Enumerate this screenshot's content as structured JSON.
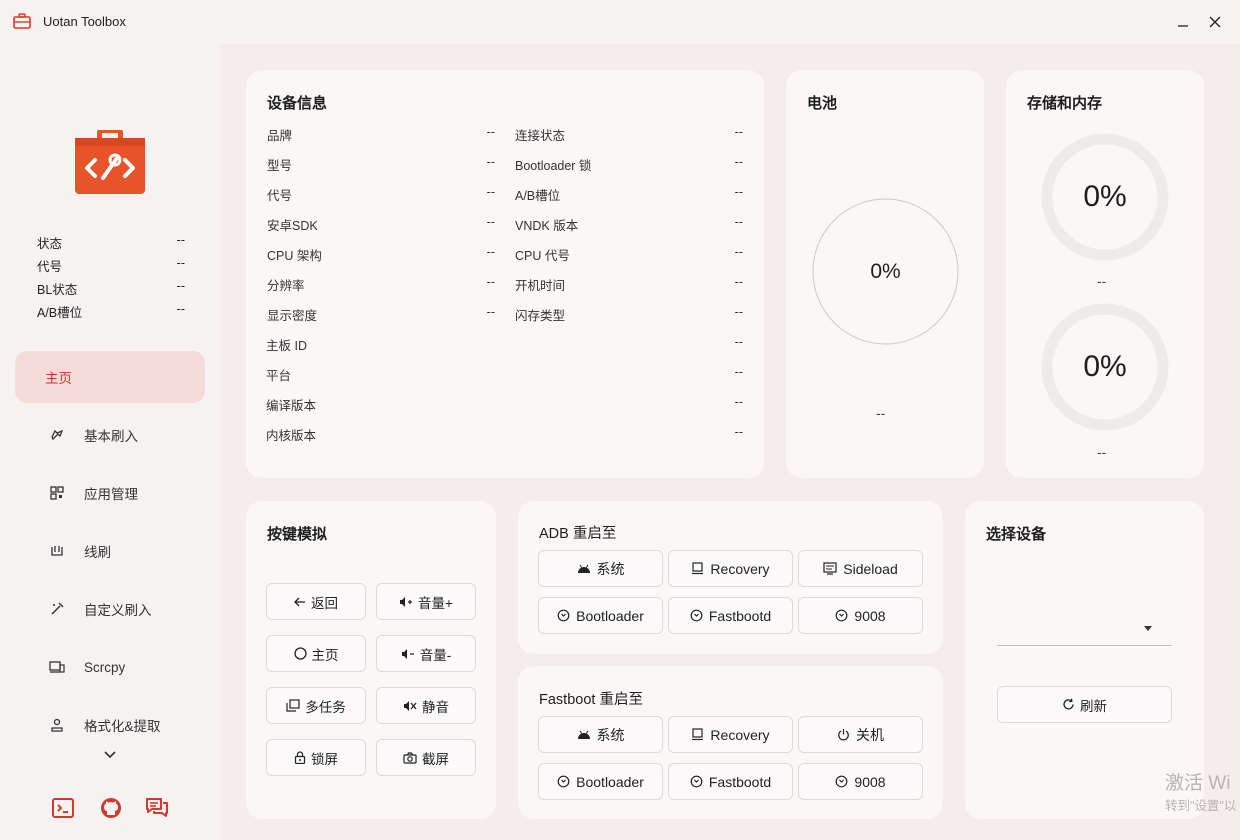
{
  "window": {
    "title": "Uotan Toolbox",
    "minimize": "−",
    "close": "✕"
  },
  "sidebar": {
    "status": [
      {
        "label": "状态",
        "value": "--"
      },
      {
        "label": "代号",
        "value": "--"
      },
      {
        "label": "BL状态",
        "value": "--"
      },
      {
        "label": "A/B槽位",
        "value": "--"
      }
    ],
    "nav": [
      {
        "label": "主页",
        "icon": "home-icon"
      },
      {
        "label": "基本刷入",
        "icon": "flash-icon"
      },
      {
        "label": "应用管理",
        "icon": "apps-icon"
      },
      {
        "label": "线刷",
        "icon": "wire-icon"
      },
      {
        "label": "自定义刷入",
        "icon": "custom-icon"
      },
      {
        "label": "Scrcpy",
        "icon": "screen-icon"
      },
      {
        "label": "格式化&提取",
        "icon": "format-icon"
      }
    ],
    "bottom_icons": [
      "terminal-icon",
      "github-icon",
      "chat-icon"
    ]
  },
  "device_info": {
    "title": "设备信息",
    "left": [
      {
        "label": "品牌",
        "value": "--"
      },
      {
        "label": "型号",
        "value": "--"
      },
      {
        "label": "代号",
        "value": "--"
      },
      {
        "label": "安卓SDK",
        "value": "--"
      },
      {
        "label": "CPU 架构",
        "value": "--"
      },
      {
        "label": "分辨率",
        "value": "--"
      },
      {
        "label": "显示密度",
        "value": "--"
      }
    ],
    "right": [
      {
        "label": "连接状态",
        "value": "--"
      },
      {
        "label": "Bootloader 锁",
        "value": "--"
      },
      {
        "label": "A/B槽位",
        "value": "--"
      },
      {
        "label": "VNDK 版本",
        "value": "--"
      },
      {
        "label": "CPU 代号",
        "value": "--"
      },
      {
        "label": "开机时间",
        "value": "--"
      },
      {
        "label": "闪存类型",
        "value": "--"
      }
    ],
    "full": [
      {
        "label": "主板 ID",
        "value": "--"
      },
      {
        "label": "平台",
        "value": "--"
      },
      {
        "label": "编译版本",
        "value": "--"
      },
      {
        "label": "内核版本",
        "value": "--"
      }
    ]
  },
  "battery": {
    "title": "电池",
    "percent": "0%",
    "status": "--"
  },
  "storage": {
    "title": "存储和内存",
    "storage_percent": "0%",
    "storage_detail": "--",
    "memory_percent": "0%",
    "memory_detail": "--"
  },
  "keys": {
    "title": "按键模拟",
    "buttons": [
      {
        "label": "返回",
        "icon": "arrow-left-icon"
      },
      {
        "label": "音量+",
        "icon": "volume-up-icon"
      },
      {
        "label": "主页",
        "icon": "circle-icon"
      },
      {
        "label": "音量-",
        "icon": "volume-down-icon"
      },
      {
        "label": "多任务",
        "icon": "multitask-icon"
      },
      {
        "label": "静音",
        "icon": "mute-icon"
      },
      {
        "label": "锁屏",
        "icon": "lock-icon"
      },
      {
        "label": "截屏",
        "icon": "camera-icon"
      }
    ]
  },
  "adb_reboot": {
    "title": "ADB 重启至",
    "buttons": [
      {
        "label": "系统",
        "icon": "android-icon"
      },
      {
        "label": "Recovery",
        "icon": "recovery-icon"
      },
      {
        "label": "Sideload",
        "icon": "sideload-icon"
      },
      {
        "label": "Bootloader",
        "icon": "reboot-icon"
      },
      {
        "label": "Fastbootd",
        "icon": "reboot-icon"
      },
      {
        "label": "9008",
        "icon": "reboot-icon"
      }
    ]
  },
  "fastboot_reboot": {
    "title": "Fastboot 重启至",
    "buttons": [
      {
        "label": "系统",
        "icon": "android-icon"
      },
      {
        "label": "Recovery",
        "icon": "recovery-icon"
      },
      {
        "label": "关机",
        "icon": "power-icon"
      },
      {
        "label": "Bootloader",
        "icon": "reboot-icon"
      },
      {
        "label": "Fastbootd",
        "icon": "reboot-icon"
      },
      {
        "label": "9008",
        "icon": "reboot-icon"
      }
    ]
  },
  "select_device": {
    "title": "选择设备",
    "value": "",
    "refresh": "刷新"
  },
  "watermark": {
    "line1": "激活 Wi",
    "line2": "转到\"设置\"以"
  },
  "colors": {
    "accent": "#c4382b",
    "logo": "#e8542a",
    "nav_active_bg": "#f6dcd8"
  }
}
